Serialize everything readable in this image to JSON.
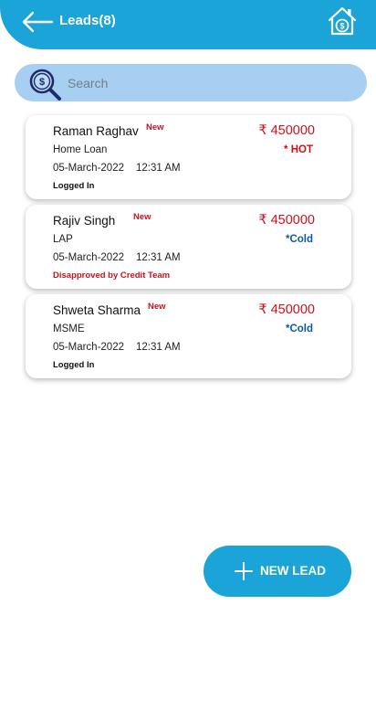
{
  "header": {
    "title": "Leads(8)",
    "back_icon": "arrow-left-icon",
    "home_icon": "home-dollar-icon",
    "bg_color": "#1ba4d8"
  },
  "search": {
    "placeholder": "Search",
    "value": "",
    "icon": "search-dollar-icon",
    "bg_color": "#a7cff2"
  },
  "leads": [
    {
      "name": "Raman Raghav",
      "badge": "New",
      "amount": "₹ 450000",
      "product": "Home Loan",
      "status": "* HOT",
      "status_color": "#d0101a",
      "date": "05-March-2022",
      "time": "12:31 AM",
      "stage": "Logged In",
      "stage_color": "#111111"
    },
    {
      "name": "Rajiv Singh",
      "badge": "New",
      "amount": "₹ 450000",
      "product": "LAP",
      "status": "*Cold",
      "status_color": "#0c5a9b",
      "date": "05-March-2022",
      "time": "12:31 AM",
      "stage": "Disapproved by Credit Team",
      "stage_color": "#d0101a"
    },
    {
      "name": "Shweta Sharma",
      "badge": "New",
      "amount": "₹ 450000",
      "product": "MSME",
      "status": "*Cold",
      "status_color": "#0c5a9b",
      "date": "05-March-2022",
      "time": "12:31 AM",
      "stage": "Logged In",
      "stage_color": "#111111"
    }
  ],
  "fab": {
    "label": "NEW LEAD",
    "icon": "plus-icon"
  }
}
